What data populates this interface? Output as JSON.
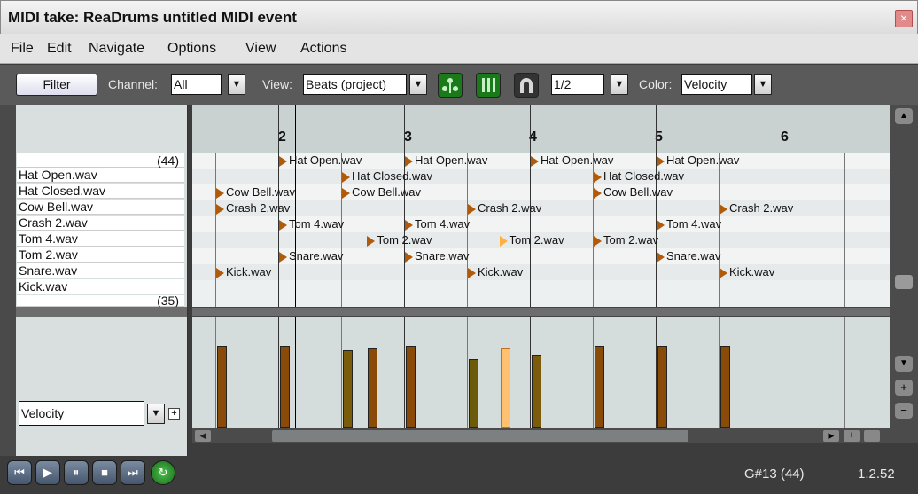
{
  "window": {
    "title": "MIDI take: ReaDrums untitled MIDI event",
    "close": "×"
  },
  "menu": [
    "File",
    "Edit",
    "Navigate",
    "Options",
    "View",
    "Actions"
  ],
  "toolbar": {
    "filter_label": "Filter",
    "channel_label": "Channel:",
    "channel_value": "All",
    "view_label": "View:",
    "view_value": "Beats (project)",
    "grid_value": "1/2",
    "color_label": "Color:",
    "color_value": "Velocity",
    "dropdown_arrow": "▼"
  },
  "keylist": {
    "top_count": "(44)",
    "bottom_count": "(35)",
    "rows": [
      "Hat Open.wav",
      "Hat Closed.wav",
      "Cow Bell.wav",
      "Crash 2.wav",
      "Tom 4.wav",
      "Tom 2.wav",
      "Snare.wav",
      "Kick.wav"
    ],
    "cc_lane_value": "Velocity",
    "cc_add": "+"
  },
  "ruler": {
    "measures": [
      "2",
      "3",
      "4",
      "5",
      "6"
    ]
  },
  "notes": [
    {
      "label": "Hat Open.wav",
      "row": 0,
      "beat": 2.0
    },
    {
      "label": "Hat Open.wav",
      "row": 0,
      "beat": 3.0
    },
    {
      "label": "Hat Open.wav",
      "row": 0,
      "beat": 4.0
    },
    {
      "label": "Hat Open.wav",
      "row": 0,
      "beat": 5.0
    },
    {
      "label": "Hat Closed.wav",
      "row": 1,
      "beat": 2.5
    },
    {
      "label": "Hat Closed.wav",
      "row": 1,
      "beat": 4.5
    },
    {
      "label": "Cow Bell.wav",
      "row": 2,
      "beat": 1.5
    },
    {
      "label": "Cow Bell.wav",
      "row": 2,
      "beat": 2.5
    },
    {
      "label": "Cow Bell.wav",
      "row": 2,
      "beat": 4.5
    },
    {
      "label": "Crash 2.wav",
      "row": 3,
      "beat": 1.5
    },
    {
      "label": "Crash 2.wav",
      "row": 3,
      "beat": 3.5
    },
    {
      "label": "Crash 2.wav",
      "row": 3,
      "beat": 5.5
    },
    {
      "label": "Tom 4.wav",
      "row": 4,
      "beat": 2.0
    },
    {
      "label": "Tom 4.wav",
      "row": 4,
      "beat": 3.0
    },
    {
      "label": "Tom 4.wav",
      "row": 4,
      "beat": 5.0
    },
    {
      "label": "Tom 2.wav",
      "row": 5,
      "beat": 2.7
    },
    {
      "label": "Tom 2.wav",
      "row": 5,
      "beat": 3.75,
      "selected": true
    },
    {
      "label": "Tom 2.wav",
      "row": 5,
      "beat": 4.5
    },
    {
      "label": "Snare.wav",
      "row": 6,
      "beat": 2.0
    },
    {
      "label": "Snare.wav",
      "row": 6,
      "beat": 3.0
    },
    {
      "label": "Snare.wav",
      "row": 6,
      "beat": 5.0
    },
    {
      "label": "Kick.wav",
      "row": 7,
      "beat": 1.5
    },
    {
      "label": "Kick.wav",
      "row": 7,
      "beat": 3.5
    },
    {
      "label": "Kick.wav",
      "row": 7,
      "beat": 5.5
    }
  ],
  "velocity_bars": [
    {
      "beat": 1.5,
      "velocity": 0.74,
      "color": "#8a4a08"
    },
    {
      "beat": 2.0,
      "velocity": 0.74,
      "color": "#8a4a08"
    },
    {
      "beat": 2.5,
      "velocity": 0.7,
      "color": "#7a5c0a"
    },
    {
      "beat": 2.7,
      "velocity": 0.72,
      "color": "#8a4a08"
    },
    {
      "beat": 3.0,
      "velocity": 0.74,
      "color": "#8a4a08"
    },
    {
      "beat": 3.5,
      "velocity": 0.62,
      "color": "#6b5a0a"
    },
    {
      "beat": 3.75,
      "velocity": 0.72,
      "color": "#ffc070",
      "selected": true
    },
    {
      "beat": 4.0,
      "velocity": 0.66,
      "color": "#7a5c0a"
    },
    {
      "beat": 4.5,
      "velocity": 0.74,
      "color": "#8a4a08"
    },
    {
      "beat": 5.0,
      "velocity": 0.74,
      "color": "#8a4a08"
    },
    {
      "beat": 5.5,
      "velocity": 0.74,
      "color": "#8a4a08"
    }
  ],
  "status": {
    "note_info": "G#13 (44)",
    "position": "1.2.52"
  },
  "transport": {
    "rewind": "⏮",
    "play": "▶",
    "pause": "⏸",
    "stop": "■",
    "forward": "⏭",
    "loop": "↻"
  },
  "colors": {
    "note_fill": "#b05a0a",
    "selected_note": "#ffb040",
    "accent_green": "#1a9b1a"
  }
}
